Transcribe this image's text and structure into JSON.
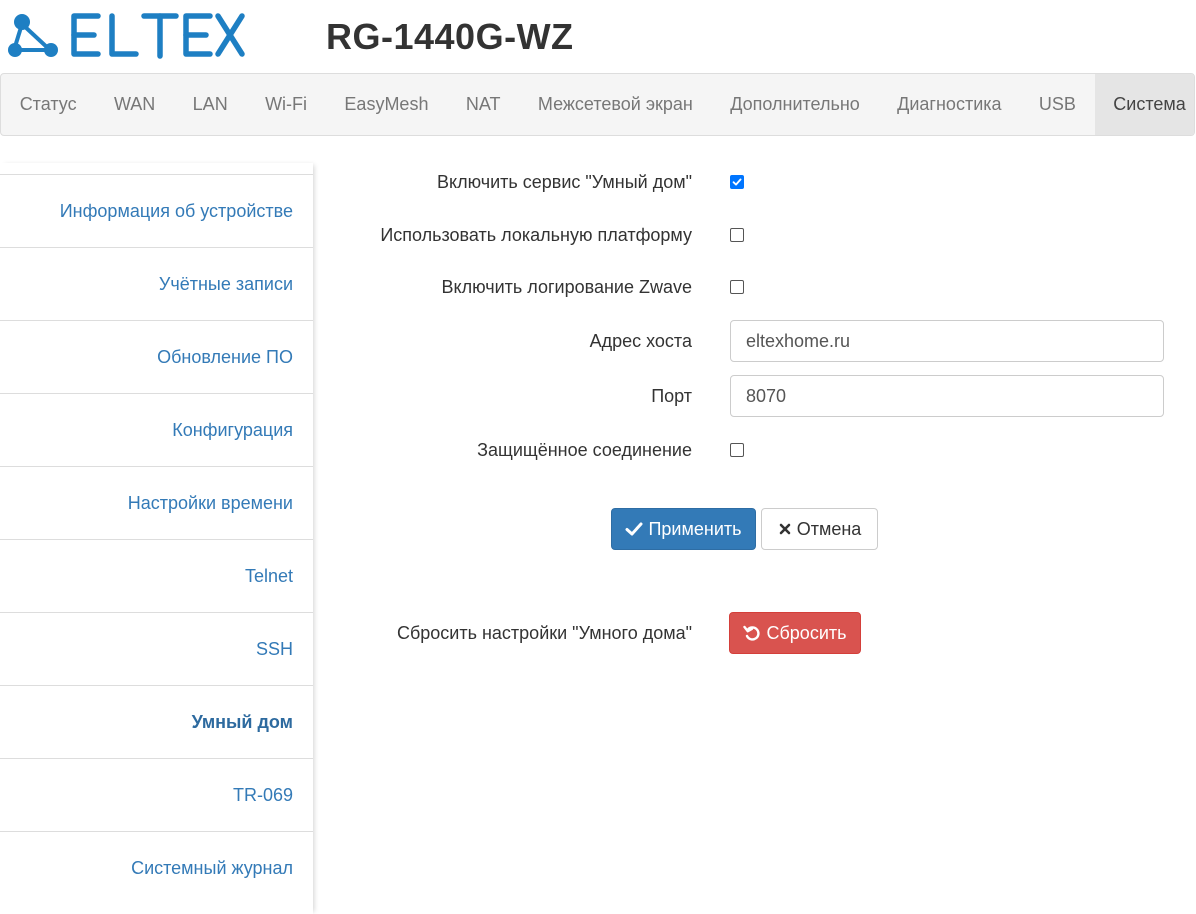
{
  "header": {
    "logo_text": "ELTEX",
    "model": "RG-1440G-WZ"
  },
  "nav": {
    "items": [
      {
        "label": "Статус"
      },
      {
        "label": "WAN"
      },
      {
        "label": "LAN"
      },
      {
        "label": "Wi-Fi"
      },
      {
        "label": "EasyMesh"
      },
      {
        "label": "NAT"
      },
      {
        "label": "Межсетевой экран"
      },
      {
        "label": "Дополнительно"
      },
      {
        "label": "Диагностика"
      },
      {
        "label": "USB"
      },
      {
        "label": "Система",
        "active": true
      }
    ]
  },
  "sidebar": {
    "items": [
      {
        "label": "Информация об устройстве"
      },
      {
        "label": "Учётные записи"
      },
      {
        "label": "Обновление ПО"
      },
      {
        "label": "Конфигурация"
      },
      {
        "label": "Настройки времени"
      },
      {
        "label": "Telnet"
      },
      {
        "label": "SSH"
      },
      {
        "label": "Умный дом",
        "active": true
      },
      {
        "label": "TR-069"
      },
      {
        "label": "Системный журнал"
      }
    ]
  },
  "form": {
    "enable_service": {
      "label": "Включить сервис \"Умный дом\"",
      "checked": true
    },
    "local_platform": {
      "label": "Использовать локальную платформу",
      "checked": false
    },
    "zwave_logging": {
      "label": "Включить логирование Zwave",
      "checked": false
    },
    "host": {
      "label": "Адрес хоста",
      "value": "eltexhome.ru"
    },
    "port": {
      "label": "Порт",
      "value": "8070"
    },
    "secure": {
      "label": "Защищённое соединение",
      "checked": false
    }
  },
  "buttons": {
    "apply": "Применить",
    "cancel": "Отмена"
  },
  "reset": {
    "label": "Сбросить настройки \"Умного дома\"",
    "button": "Сбросить"
  },
  "colors": {
    "brand": "#1e7fc3",
    "link": "#337ab7",
    "primary": "#337ab7",
    "danger": "#d9534f"
  },
  "icons": {
    "apply": "check-icon",
    "cancel": "close-icon",
    "reset": "undo-icon",
    "logo": "eltex-network-icon"
  }
}
